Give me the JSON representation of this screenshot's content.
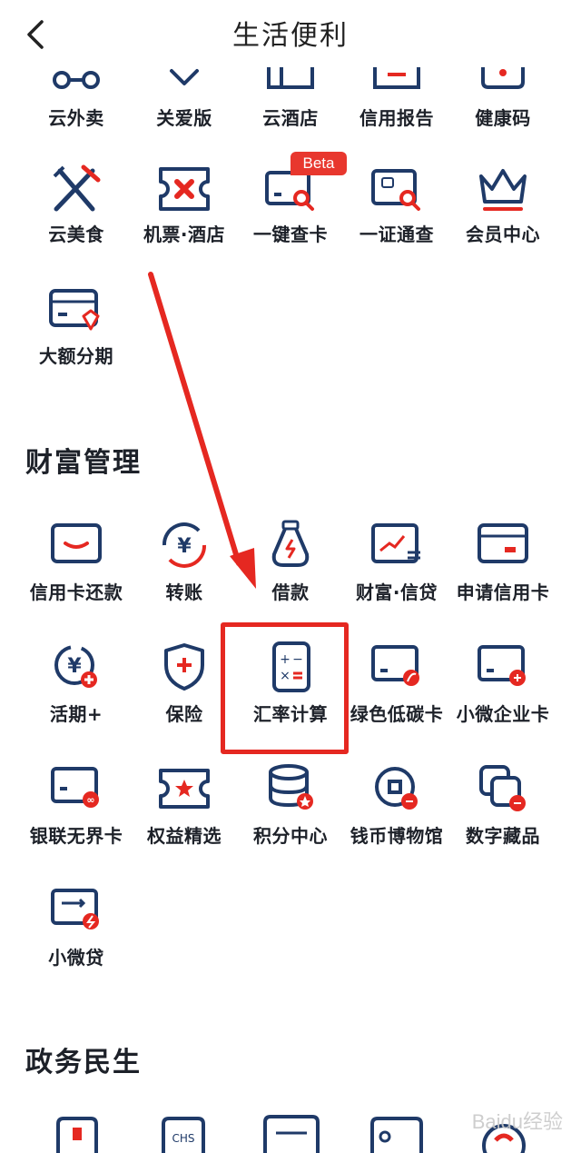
{
  "header": {
    "title": "生活便利"
  },
  "life": {
    "row0": [
      "云外卖",
      "关爱版",
      "云酒店",
      "信用报告",
      "健康码"
    ],
    "row1": [
      "云美食",
      "机票·酒店",
      "一键查卡",
      "一证通查",
      "会员中心"
    ],
    "row2": [
      "大额分期"
    ],
    "beta_badge": "Beta"
  },
  "wealth": {
    "title": "财富管理",
    "row0": [
      "信用卡还款",
      "转账",
      "借款",
      "财富·信贷",
      "申请信用卡"
    ],
    "row1": [
      "活期+",
      "保险",
      "汇率计算",
      "绿色低碳卡",
      "小微企业卡"
    ],
    "row2": [
      "银联无界卡",
      "权益精选",
      "积分中心",
      "钱币博物馆",
      "数字藏品"
    ],
    "row3": [
      "小微贷"
    ]
  },
  "gov": {
    "title": "政务民生"
  },
  "watermark": "Baidu经验",
  "colors": {
    "navy": "#1f3a68",
    "red": "#e52821"
  }
}
